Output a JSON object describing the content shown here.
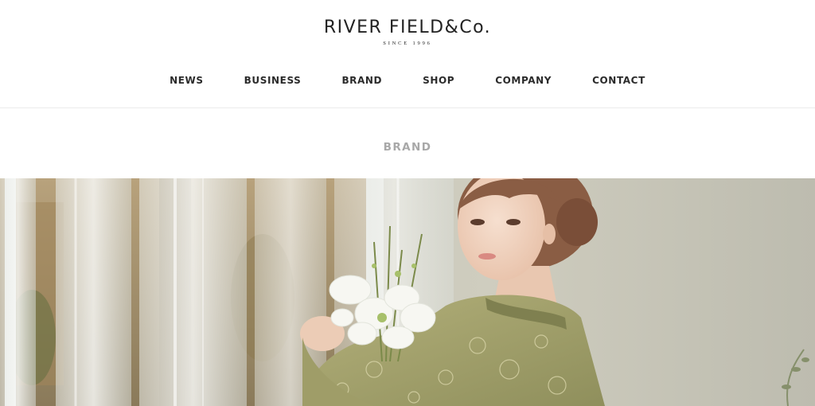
{
  "header": {
    "logo": {
      "name": "RIVER FIELD&Co.",
      "since": "SINCE 1996"
    },
    "nav": [
      {
        "label": "NEWS"
      },
      {
        "label": "BUSINESS"
      },
      {
        "label": "BRAND"
      },
      {
        "label": "SHOP"
      },
      {
        "label": "COMPANY"
      },
      {
        "label": "CONTACT"
      }
    ]
  },
  "page": {
    "heading": "BRAND"
  },
  "colors": {
    "text": "#2b2b2b",
    "heading_gray": "#a8a8a8",
    "divider": "#ececec",
    "dress_green": "#a3a370"
  }
}
